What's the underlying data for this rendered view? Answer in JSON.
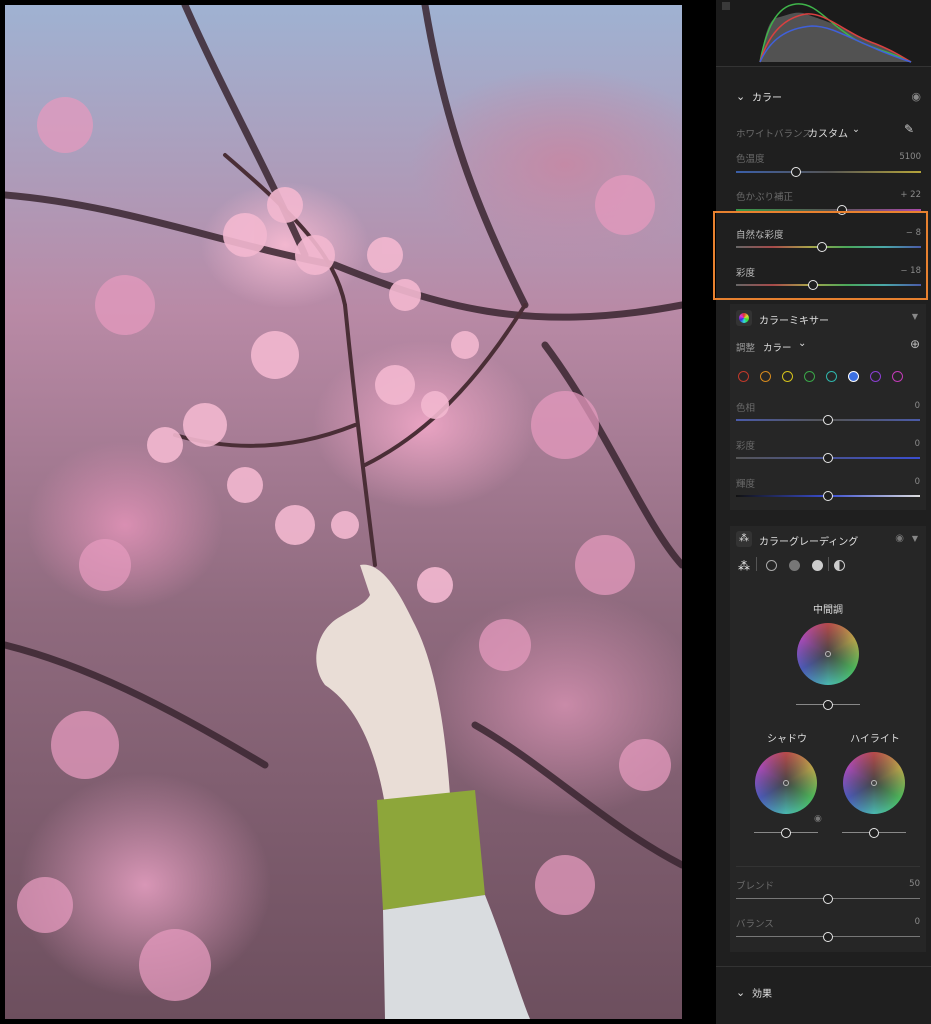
{
  "color_section": {
    "title": "カラー",
    "white_balance_label": "ホワイトバランス",
    "white_balance_value": "カスタム",
    "temp": {
      "label": "色温度",
      "value": "5100",
      "level": 0.33
    },
    "tint": {
      "label": "色かぶり補正",
      "value": "+ 22",
      "level": 0.57
    },
    "vibrance": {
      "label": "自然な彩度",
      "value": "− 8",
      "level": 0.46
    },
    "saturation": {
      "label": "彩度",
      "value": "− 18",
      "level": 0.42
    }
  },
  "color_mixer": {
    "title": "カラーミキサー",
    "adjust_label": "調整",
    "adjust_value": "カラー",
    "swatches": [
      "#c0392b",
      "#d68a1e",
      "#d4c21c",
      "#3aa648",
      "#2fb5ab",
      "#3b6fe0",
      "#8a3fd1",
      "#c23bb8"
    ],
    "selected_index": 5,
    "hue": {
      "label": "色相",
      "value": "0",
      "level": 0.5
    },
    "saturation": {
      "label": "彩度",
      "value": "0",
      "level": 0.5
    },
    "luminance": {
      "label": "輝度",
      "value": "0",
      "level": 0.5
    }
  },
  "color_grading": {
    "title": "カラーグレーディング",
    "midtones_label": "中間調",
    "shadows_label": "シャドウ",
    "highlights_label": "ハイライト",
    "blend": {
      "label": "ブレンド",
      "value": "50",
      "level": 0.5
    },
    "balance": {
      "label": "バランス",
      "value": "0",
      "level": 0.5
    }
  },
  "effects_section": {
    "title": "効果"
  },
  "colors": {
    "highlight": "#e8812f",
    "panel_bg": "#1f1f1f",
    "subpanel_bg": "#262626"
  }
}
